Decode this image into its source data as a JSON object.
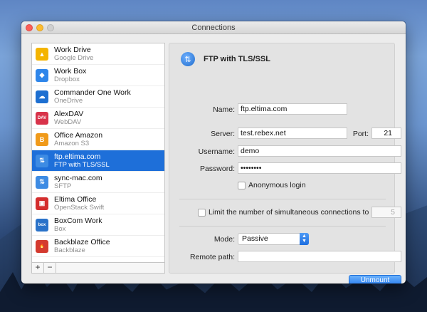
{
  "window": {
    "title": "Connections"
  },
  "connections": [
    {
      "name": "Work Drive",
      "sub": "Google Drive",
      "icon": "google-drive-icon",
      "color": "#f4b400",
      "glyph": "▲"
    },
    {
      "name": "Work Box",
      "sub": "Dropbox",
      "icon": "dropbox-icon",
      "color": "#2f86ea",
      "glyph": "◆"
    },
    {
      "name": "Commander One Work",
      "sub": "OneDrive",
      "icon": "onedrive-icon",
      "color": "#1d6fd1",
      "glyph": "☁"
    },
    {
      "name": "AlexDAV",
      "sub": "WebDAV",
      "icon": "webdav-icon",
      "color": "#d8334a",
      "glyph": "DAV"
    },
    {
      "name": "Office Amazon",
      "sub": "Amazon S3",
      "icon": "amazon-s3-icon",
      "color": "#f09a1a",
      "glyph": "B"
    },
    {
      "name": "ftp.eltima.com",
      "sub": "FTP with TLS/SSL",
      "icon": "ftp-icon",
      "color": "#3d8be3",
      "glyph": "⇅"
    },
    {
      "name": "sync-mac.com",
      "sub": "SFTP",
      "icon": "sftp-icon",
      "color": "#3d8be3",
      "glyph": "⇅"
    },
    {
      "name": "Eltima Office",
      "sub": "OpenStack Swift",
      "icon": "openstack-icon",
      "color": "#d42e2e",
      "glyph": "▣"
    },
    {
      "name": "BoxCom Work",
      "sub": "Box",
      "icon": "box-icon",
      "color": "#2a72c9",
      "glyph": "box"
    },
    {
      "name": "Backblaze Office",
      "sub": "Backblaze",
      "icon": "backblaze-icon",
      "color": "#d43a2f",
      "glyph": "🔥"
    }
  ],
  "selected_index": 5,
  "sidebar_footer": {
    "add": "+",
    "remove": "−"
  },
  "detail": {
    "title": "FTP with TLS/SSL",
    "name_label": "Name:",
    "name_value": "ftp.eltima.com",
    "server_label": "Server:",
    "server_value": "test.rebex.net",
    "port_label": "Port:",
    "port_value": "21",
    "username_label": "Username:",
    "username_value": "demo",
    "password_label": "Password:",
    "password_value": "••••••••",
    "anonymous_label": "Anonymous login",
    "limit_label": "Limit the number of simultaneous connections to",
    "limit_value": "5",
    "mode_label": "Mode:",
    "mode_value": "Passive",
    "remote_label": "Remote path:",
    "remote_value": "",
    "unmount_label": "Unmount"
  }
}
